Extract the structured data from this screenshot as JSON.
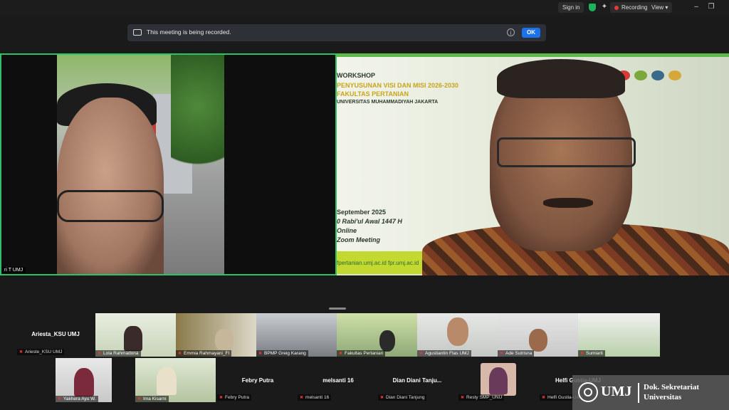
{
  "topbar": {
    "sign_in": "Sign in",
    "recording": "Recording",
    "view": "View",
    "colors": {
      "shield": "#1cb35a",
      "rec_dot": "#e53935"
    }
  },
  "banner": {
    "text": "This meeting is being recorded.",
    "ok": "OK",
    "info_icon": "info-icon"
  },
  "left_speaker": {
    "name_fragment": "ri T UMJ"
  },
  "slide": {
    "workshop": "WORKSHOP",
    "line1": "PENYUSUNAN VISI DAN MISI 2026-2030",
    "line2": "FAKULTAS PERTANIAN",
    "line3": "UNIVERSITAS MUHAMMADIYAH JAKARTA",
    "date": "September 2025",
    "hijri": "0 Rabi'ul Awal 1447 H",
    "mode": "Online",
    "platform": "Zoom Meeting",
    "footer": "fpertanian.umj.ac.id   fpr.umj.ac.id"
  },
  "gallery_row1": [
    {
      "name": "Arieste_KSU UMJ",
      "type": "text",
      "title": "Ariesta_KSU UMJ"
    },
    {
      "name": "Lola Rahmadona",
      "type": "video"
    },
    {
      "name": "Emmia Rahmayani_FI",
      "type": "video"
    },
    {
      "name": "BPMP Greig Karang",
      "type": "video"
    },
    {
      "name": "Fakultas Pertanian",
      "type": "video"
    },
    {
      "name": "Agustiantin Ftas UMJ",
      "type": "video"
    },
    {
      "name": "Ade Sutrisna",
      "type": "video"
    },
    {
      "name": "Sumiarti",
      "type": "video"
    }
  ],
  "gallery_row2": [
    {
      "name": "Yakhera Ayu W.",
      "type": "video"
    },
    {
      "name": "Ima Kisarni",
      "type": "video"
    },
    {
      "name": "Febry Putra",
      "type": "text",
      "title": "Febry Putra"
    },
    {
      "name": "melsanti 16",
      "type": "text",
      "title": "melsanti 16"
    },
    {
      "name": "Dian Diani Tanjung",
      "type": "text",
      "title": "Dian Diani Tanju..."
    },
    {
      "name": "Resty SMP_UNU",
      "type": "video"
    },
    {
      "name": "Helfi Gustia-UMJ",
      "type": "text",
      "title": "Helfi Gustia-UMJ"
    }
  ],
  "watermark": {
    "umj": "UMJ",
    "line1": "Dok. Sekretariat",
    "line2": "Universitas"
  }
}
